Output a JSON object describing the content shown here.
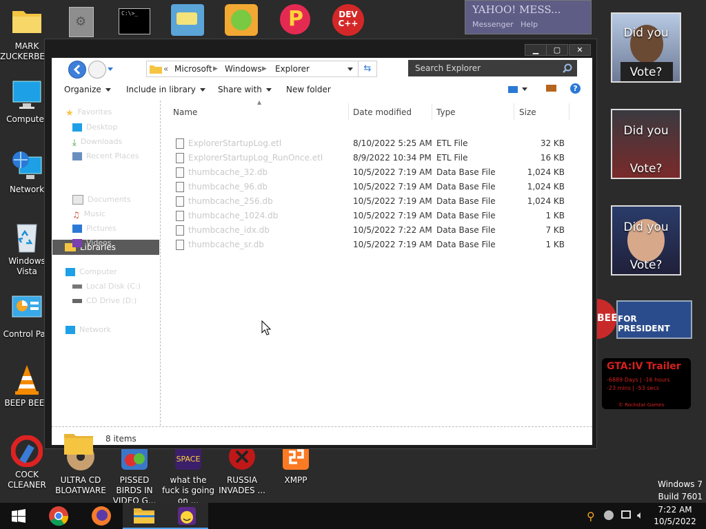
{
  "desktop_icons": [
    {
      "id": "mark",
      "label": "MARK ZUCKERBERG"
    },
    {
      "id": "computer",
      "label": "Computer"
    },
    {
      "id": "network",
      "label": "Network"
    },
    {
      "id": "vista",
      "label": "Windows Vista"
    },
    {
      "id": "cpanel",
      "label": "Control Pan"
    },
    {
      "id": "beep",
      "label": "BEEP BEEP"
    },
    {
      "id": "cock",
      "label": "COCK CLEANER"
    },
    {
      "id": "ultracd",
      "label": "ULTRA CD BLOATWARE"
    },
    {
      "id": "pissed",
      "label": "PISSED BIRDS IN VIDEO G..."
    },
    {
      "id": "wtf",
      "label": "what the fuck is going on ..."
    },
    {
      "id": "russia",
      "label": "RUSSIA INVADES ..."
    },
    {
      "id": "xmpp",
      "label": "XMPP"
    }
  ],
  "top_icons": [
    {
      "id": "gear",
      "glyph": "⚙"
    },
    {
      "id": "cmd",
      "text": "C:\\>_"
    },
    {
      "id": "blue",
      "glyph": "≡"
    },
    {
      "id": "pig",
      "glyph": "◉"
    },
    {
      "id": "p",
      "text": "P"
    },
    {
      "id": "devcpp",
      "text": "DEV C++"
    }
  ],
  "yahoo": {
    "title": "YAHOO! MESS...",
    "subtitle": "Messenger",
    "help": "Help"
  },
  "explorer": {
    "back_label": "Back",
    "forward_label": "Forward",
    "breadcrumb": [
      "«",
      "Microsoft",
      "Windows",
      "Explorer"
    ],
    "search_placeholder": "Search Explorer",
    "commands": {
      "organize": "Organize",
      "include": "Include in library",
      "share": "Share with",
      "newfolder": "New folder"
    },
    "nav": [
      {
        "label": "Favorites",
        "kind": "head"
      },
      {
        "label": "Desktop",
        "kind": "item"
      },
      {
        "label": "Downloads",
        "kind": "item"
      },
      {
        "label": "Recent Places",
        "kind": "item"
      },
      {
        "label": "Libraries",
        "kind": "selected"
      },
      {
        "label": "Documents",
        "kind": "item"
      },
      {
        "label": "Music",
        "kind": "item"
      },
      {
        "label": "Pictures",
        "kind": "item"
      },
      {
        "label": "Videos",
        "kind": "item"
      },
      {
        "label": "Computer",
        "kind": "head"
      },
      {
        "label": "Local Disk (C:)",
        "kind": "item"
      },
      {
        "label": "CD Drive (D:)",
        "kind": "item"
      },
      {
        "label": "Network",
        "kind": "head"
      }
    ],
    "columns": {
      "name": "Name",
      "date": "Date modified",
      "type": "Type",
      "size": "Size"
    },
    "files": [
      {
        "name": "ExplorerStartupLog.etl",
        "date": "8/10/2022 5:25 AM",
        "type": "ETL File",
        "size": "32 KB"
      },
      {
        "name": "ExplorerStartupLog_RunOnce.etl",
        "date": "8/9/2022 10:34 PM",
        "type": "ETL File",
        "size": "16 KB"
      },
      {
        "name": "thumbcache_32.db",
        "date": "10/5/2022 7:19 AM",
        "type": "Data Base File",
        "size": "1,024 KB"
      },
      {
        "name": "thumbcache_96.db",
        "date": "10/5/2022 7:19 AM",
        "type": "Data Base File",
        "size": "1,024 KB"
      },
      {
        "name": "thumbcache_256.db",
        "date": "10/5/2022 7:19 AM",
        "type": "Data Base File",
        "size": "1,024 KB"
      },
      {
        "name": "thumbcache_1024.db",
        "date": "10/5/2022 7:19 AM",
        "type": "Data Base File",
        "size": "1 KB"
      },
      {
        "name": "thumbcache_idx.db",
        "date": "10/5/2022 7:22 AM",
        "type": "Data Base File",
        "size": "7 KB"
      },
      {
        "name": "thumbcache_sr.db",
        "date": "10/5/2022 7:19 AM",
        "type": "Data Base File",
        "size": "1 KB"
      }
    ],
    "status": "8 items"
  },
  "gadgets": {
    "vote_line1": "Did you",
    "vote_line2": "Vote?",
    "bee": "FOR PRESIDENT",
    "bee_left": "BEE",
    "gta_title": "GTA:IV Trailer",
    "gta_days": "-6889 Days  |  -16 hours",
    "gta_mins": "-23 mins  |  -53 secs",
    "gta_footer": "© Rockstar Games"
  },
  "watermark": {
    "line1": "Windows 7",
    "line2": "Build 7601"
  },
  "tray": {
    "time": "7:22 AM",
    "date": "10/5/2022"
  },
  "colors": {
    "folder": "#f5c542",
    "accent": "#2b79d6",
    "gta_red": "#d62020"
  }
}
